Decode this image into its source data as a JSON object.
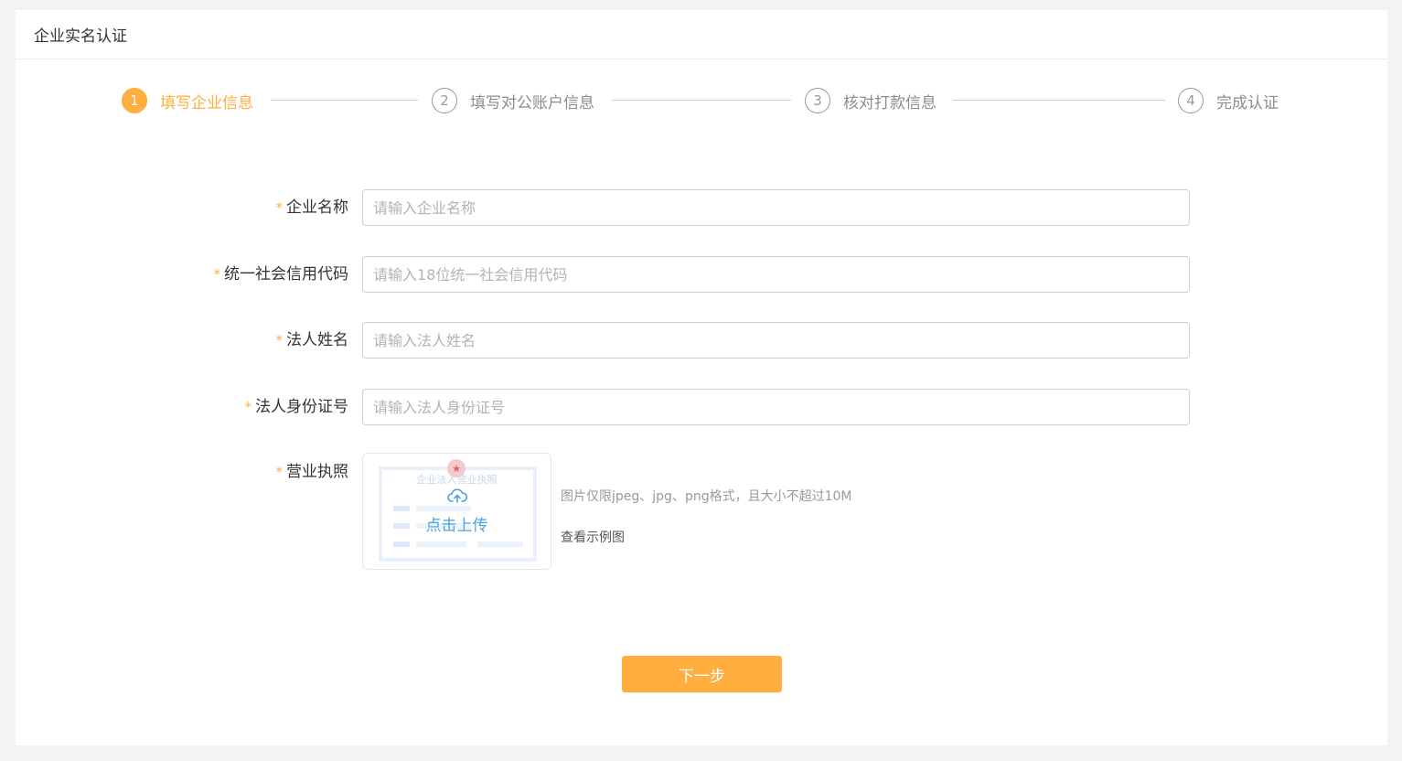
{
  "header": {
    "title": "企业实名认证"
  },
  "steps": [
    {
      "num": "1",
      "label": "填写企业信息",
      "active": true
    },
    {
      "num": "2",
      "label": "填写对公账户信息",
      "active": false
    },
    {
      "num": "3",
      "label": "核对打款信息",
      "active": false
    },
    {
      "num": "4",
      "label": "完成认证",
      "active": false
    }
  ],
  "form": {
    "required_mark": "*",
    "company_name": {
      "label": "企业名称",
      "placeholder": "请输入企业名称",
      "value": ""
    },
    "credit_code": {
      "label": "统一社会信用代码",
      "placeholder": "请输入18位统一社会信用代码",
      "value": ""
    },
    "legal_name": {
      "label": "法人姓名",
      "placeholder": "请输入法人姓名",
      "value": ""
    },
    "legal_id": {
      "label": "法人身份证号",
      "placeholder": "请输入法人身份证号",
      "value": ""
    },
    "license": {
      "label": "营业执照",
      "upload_text": "点击上传",
      "preview_title": "企业法人营业执照",
      "hint": "图片仅限jpeg、jpg、png格式，且大小不超过10M",
      "sample_link": "查看示例图"
    }
  },
  "actions": {
    "next_label": "下一步"
  },
  "colors": {
    "accent": "#ffae3f",
    "upload_blue": "#4aa3df",
    "border": "#cfcfcf"
  }
}
